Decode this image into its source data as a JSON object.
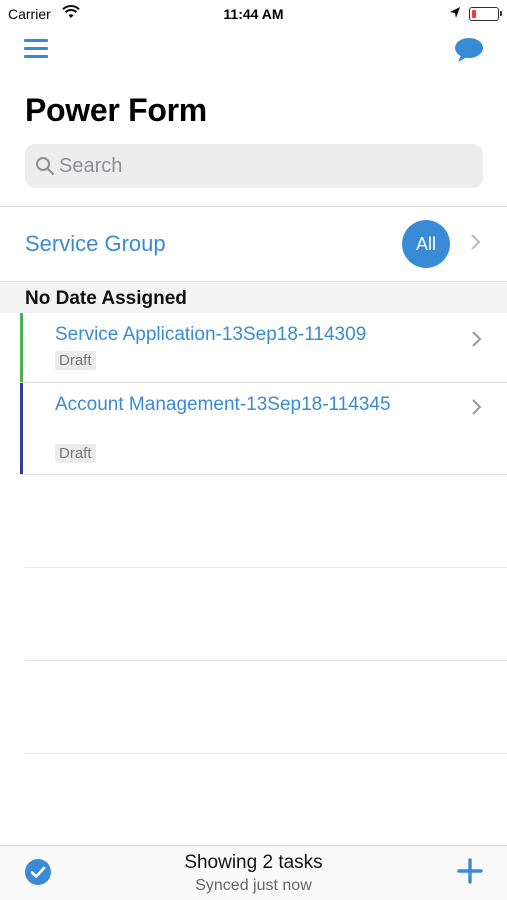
{
  "status_bar": {
    "carrier": "Carrier",
    "time": "11:44 AM",
    "battery_color": "#ff3b30"
  },
  "nav": {
    "menu_icon": "hamburger-menu-icon",
    "chat_icon": "chat-bubble-icon"
  },
  "page": {
    "title": "Power Form"
  },
  "search": {
    "placeholder": "Search",
    "value": ""
  },
  "group": {
    "label": "Service Group",
    "badge": "All"
  },
  "section": {
    "header": "No Date Assigned"
  },
  "tasks": [
    {
      "title": "Service Application-13Sep18-114309",
      "status": "Draft",
      "stripe_color": "#4cb04c"
    },
    {
      "title": "Account Management-13Sep18-114345",
      "status": "Draft",
      "stripe_color": "#2e3d9a"
    }
  ],
  "footer": {
    "summary": "Showing 2 tasks",
    "sync_status": "Synced just now"
  },
  "theme": {
    "accent": "#3a8bd6"
  }
}
